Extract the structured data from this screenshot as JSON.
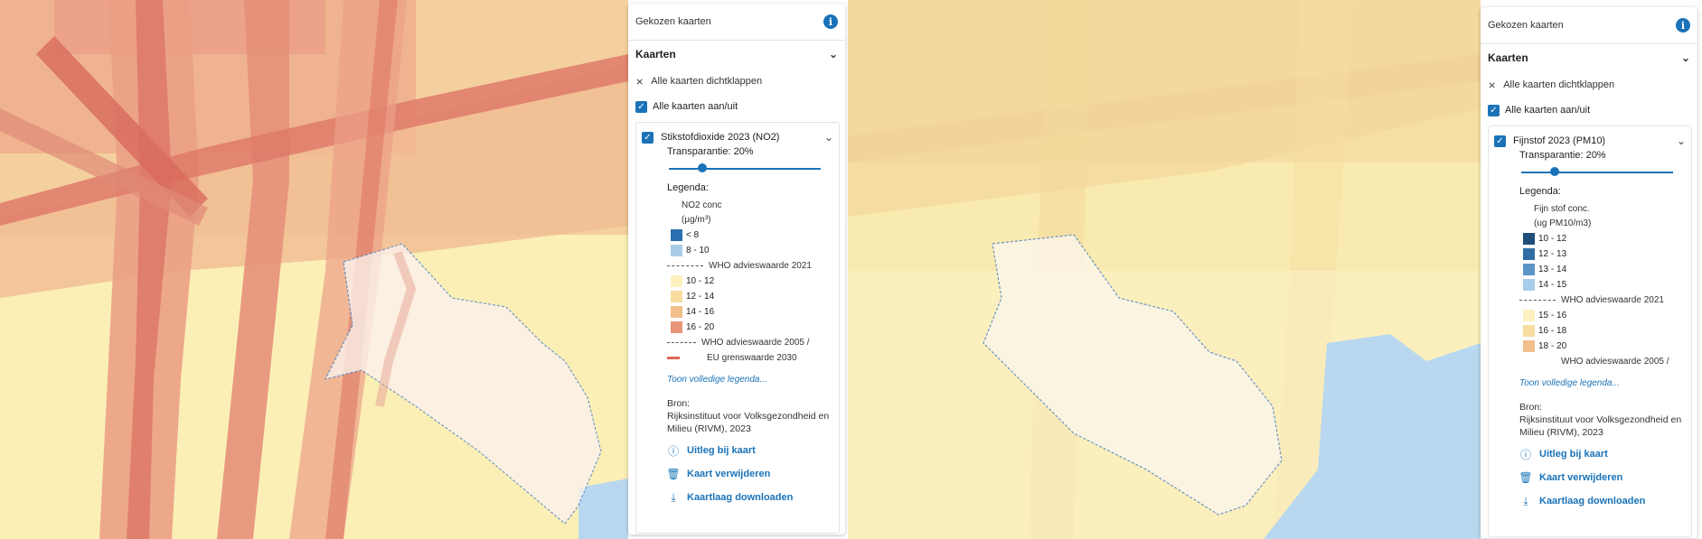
{
  "left": {
    "panel": {
      "header_title": "Gekozen kaarten",
      "section": "Kaarten",
      "collapse_all": "Alle kaarten dichtklappen",
      "toggle_all": "Alle kaarten aan/uit",
      "layer_title": "Stikstofdioxide 2023 (NO2)",
      "transparency": "Transparantie: 20%",
      "transparency_value": 0.2,
      "legend_label": "Legenda:",
      "unit_line1": "NO2 conc",
      "unit_line2": "(µg/m³)",
      "legend_items": [
        {
          "label": "< 8",
          "color": "#2a6fb0"
        },
        {
          "label": "8 - 10",
          "color": "#a9cce8"
        }
      ],
      "who_2021": "WHO advieswaarde 2021",
      "legend_items_2": [
        {
          "label": "10 - 12",
          "color": "#fdf1c0"
        },
        {
          "label": "12 - 14",
          "color": "#f8dca0"
        },
        {
          "label": "14 - 16",
          "color": "#f2bf8c"
        },
        {
          "label": "16 - 20",
          "color": "#e8957a"
        }
      ],
      "who_2005_1": "WHO advieswaarde 2005 /",
      "who_2005_2": "EU grenswaarde 2030",
      "show_full_legend": "Toon volledige legenda...",
      "source_label": "Bron:",
      "source_text": "Rijksinstituut voor Volksgezondheid en Milieu (RIVM), 2023",
      "action_explain": "Uitleg bij kaart",
      "action_remove": "Kaart verwijderen",
      "action_download": "Kaartlaag downloaden"
    }
  },
  "right": {
    "panel": {
      "header_title": "Gekozen kaarten",
      "section": "Kaarten",
      "collapse_all": "Alle kaarten dichtklappen",
      "toggle_all": "Alle kaarten aan/uit",
      "layer_title": "Fijnstof 2023 (PM10)",
      "transparency": "Transparantie: 20%",
      "transparency_value": 0.2,
      "legend_label": "Legenda:",
      "unit_line1": "Fijn stof conc.",
      "unit_line2": "(ug PM10/m3)",
      "legend_items": [
        {
          "label": "10 - 12",
          "color": "#1f4e79"
        },
        {
          "label": "12 - 13",
          "color": "#2f6ea5"
        },
        {
          "label": "13 - 14",
          "color": "#5d95c9"
        },
        {
          "label": "14 - 15",
          "color": "#a9cce8"
        }
      ],
      "who_2021": "WHO advieswaarde 2021",
      "legend_items_2": [
        {
          "label": "15 - 16",
          "color": "#fdf1c0"
        },
        {
          "label": "16 - 18",
          "color": "#f8dca0"
        },
        {
          "label": "18 - 20",
          "color": "#f2bf8c"
        }
      ],
      "who_2005_1": "WHO advieswaarde 2005 /",
      "show_full_legend": "Toon volledige legenda...",
      "source_label": "Bron:",
      "source_text": "Rijksinstituut voor Volksgezondheid en Milieu (RIVM), 2023",
      "action_explain": "Uitleg bij kaart",
      "action_remove": "Kaart verwijderen",
      "action_download": "Kaartlaag downloaden"
    }
  },
  "colors": {
    "accent": "#1a73b8",
    "no2_base": "#f6d9a8",
    "no2_road": "#d9685a",
    "pm10_base": "#f9e6a6",
    "water": "#b9d8ef"
  }
}
